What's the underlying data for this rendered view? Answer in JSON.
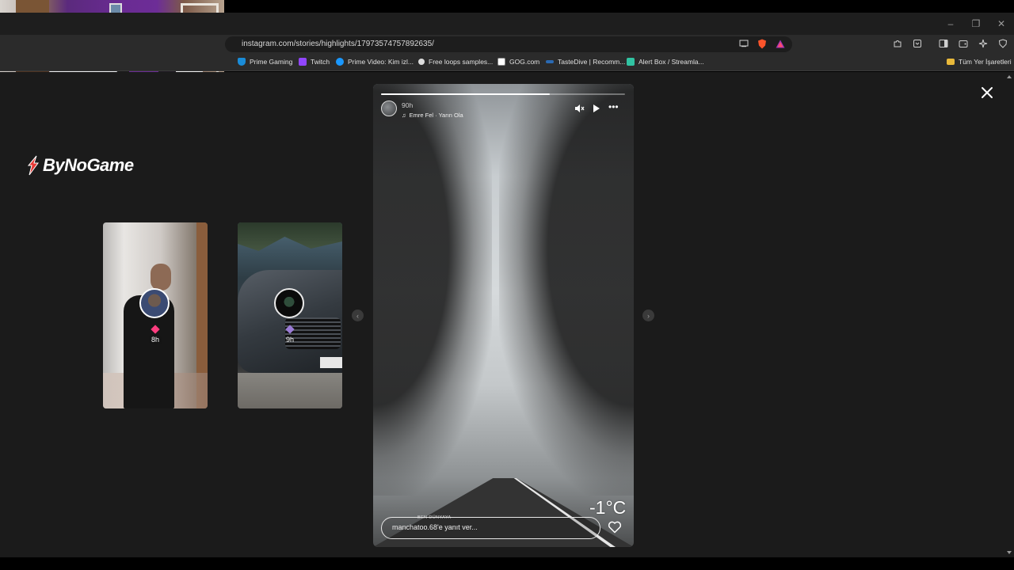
{
  "browser": {
    "url": "instagram.com/stories/highlights/17973574757892635/",
    "window_controls": {
      "minimize": "–",
      "restore": "❐",
      "close": "✕"
    },
    "bookmarks": [
      {
        "label": "Prime Gaming",
        "color": "#1a8cd8"
      },
      {
        "label": "Twitch",
        "color": "#9146ff"
      },
      {
        "label": "Prime Video: Kim izl...",
        "color": "#1a98ff"
      },
      {
        "label": "Free loops samples...",
        "color": "#dddddd"
      },
      {
        "label": "GOG.com",
        "color": "#ffffff"
      },
      {
        "label": "TasteDive | Recomm...",
        "color": "#2a6ab3"
      },
      {
        "label": "Alert Box / Streamla...",
        "color": "#31c3a2"
      }
    ],
    "all_bookmarks_label": "Tüm Yer İşaretleri"
  },
  "brand": {
    "name": "ByNoGame",
    "accent": "#e53935"
  },
  "previews": [
    {
      "time": "8h",
      "dot_color": "#ff3d7f"
    },
    {
      "time": "9h",
      "dot_color": "#9b7bd6"
    }
  ],
  "story": {
    "age": "90h",
    "music": "Emre Fel · Yarın Ola",
    "progress_fraction": 0.69,
    "location": "BEN DÜNYAYA",
    "temperature": "-1°C",
    "reply_placeholder": "manchatoo.68'e yanıt ver..."
  },
  "controls": {
    "mute_icon": "speaker-muted-icon",
    "play_icon": "play-icon",
    "more_icon": "more-icon",
    "prev_icon": "chevron-left-icon",
    "next_icon": "chevron-right-icon",
    "close_icon": "close-icon"
  }
}
